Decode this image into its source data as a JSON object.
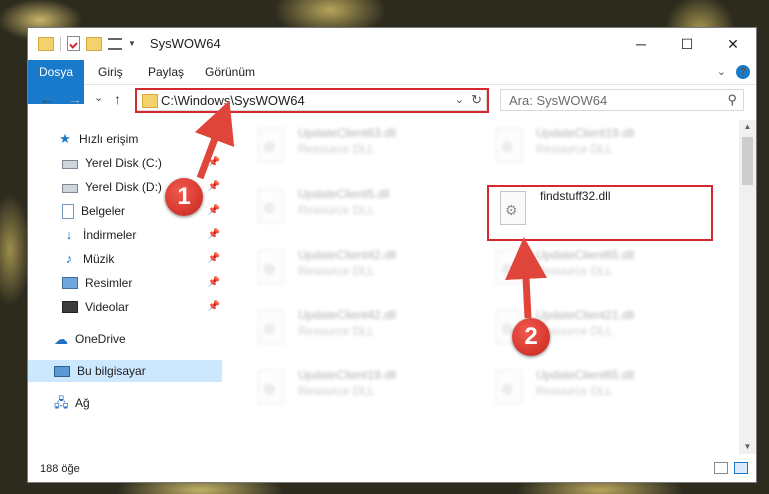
{
  "window": {
    "title": "SysWOW64",
    "controls": {
      "minimize": "─",
      "maximize": "☐",
      "close": "✕"
    }
  },
  "ribbon": {
    "tabs": [
      "Dosya",
      "Giriş",
      "Paylaş",
      "Görünüm"
    ],
    "expand": "⌄",
    "help": "?"
  },
  "nav": {
    "back": "←",
    "forward": "→",
    "recent": "⌄",
    "up": "↑"
  },
  "address": {
    "path": "C:\\Windows\\SysWOW64",
    "dropdown": "⌄",
    "refresh": "↻"
  },
  "search": {
    "placeholder": "Ara: SysWOW64",
    "icon": "⚲"
  },
  "sidebar": {
    "items": [
      {
        "label": "Hızlı erişim",
        "icon": "star-icon"
      },
      {
        "label": "Yerel Disk (C:)",
        "icon": "drive-icon",
        "pinned": true
      },
      {
        "label": "Yerel Disk (D:)",
        "icon": "drive-icon",
        "pinned": true
      },
      {
        "label": "Belgeler",
        "icon": "documents-icon",
        "pinned": true
      },
      {
        "label": "İndirmeler",
        "icon": "download-icon",
        "pinned": true
      },
      {
        "label": "Müzik",
        "icon": "music-icon",
        "pinned": true
      },
      {
        "label": "Resimler",
        "icon": "pictures-icon",
        "pinned": true
      },
      {
        "label": "Videolar",
        "icon": "videos-icon",
        "pinned": true
      },
      {
        "label": "OneDrive",
        "icon": "cloud-icon"
      },
      {
        "label": "Bu bilgisayar",
        "icon": "computer-icon",
        "selected": true
      },
      {
        "label": "Ağ",
        "icon": "network-icon"
      }
    ],
    "pin_glyph": "📌"
  },
  "files": {
    "items": [
      {
        "name": "UpdateClient63.dll",
        "type": "Resource DLL"
      },
      {
        "name": "UpdateClient19.dll",
        "type": "Resource DLL"
      },
      {
        "name": "UpdateClient5.dll",
        "type": "Resource DLL"
      },
      {
        "name": "findstuff32.dll",
        "type": ""
      },
      {
        "name": "UpdateClient42.dll",
        "type": "Resource DLL"
      },
      {
        "name": "UpdateClient65.dll",
        "type": "Resource DLL"
      },
      {
        "name": "UpdateClient42.dll",
        "type": "Resource DLL"
      },
      {
        "name": "UpdateClient21.dll",
        "type": "Resource DLL"
      },
      {
        "name": "UpdateClient19.dll",
        "type": "Resource DLL"
      },
      {
        "name": "UpdateClient65.dll",
        "type": "Resource DLL"
      }
    ]
  },
  "status": {
    "count": "188 öğe"
  },
  "annotations": {
    "step1": "1",
    "step2": "2"
  },
  "colors": {
    "accent": "#1979ca",
    "highlight": "#d8282f",
    "selected": "#cce8ff"
  }
}
